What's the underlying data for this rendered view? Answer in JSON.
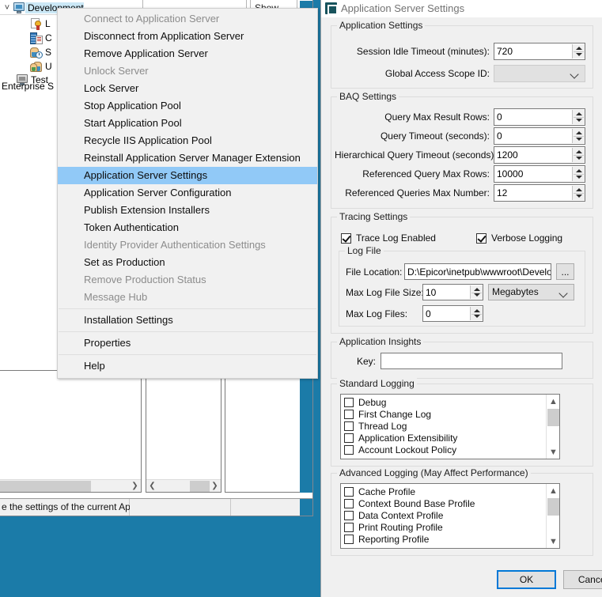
{
  "background_window": {
    "toolbar": {
      "show_label": "Show ..."
    },
    "tree": {
      "root": {
        "label": "Development",
        "icon": "monitor-icon",
        "expanded": true,
        "selected": true
      },
      "children": [
        {
          "label": "L",
          "icon": "certificate-icon"
        },
        {
          "label": "C",
          "icon": "company-icon"
        },
        {
          "label": "S",
          "icon": "sessions-icon"
        },
        {
          "label": "U",
          "icon": "users-icon"
        }
      ],
      "sibling": {
        "label": "Test",
        "icon": "monitor-gray-icon"
      },
      "footer": "Enterprise S"
    },
    "statusbar": {
      "text": "e the settings of the current App"
    }
  },
  "context_menu": {
    "items": [
      {
        "label": "Connect to Application Server",
        "disabled": true,
        "selected": false
      },
      {
        "label": "Disconnect from Application Server",
        "disabled": false,
        "selected": false
      },
      {
        "label": "Remove Application Server",
        "disabled": false,
        "selected": false
      },
      {
        "label": "Unlock Server",
        "disabled": true,
        "selected": false
      },
      {
        "label": "Lock Server",
        "disabled": false,
        "selected": false
      },
      {
        "label": "Stop Application Pool",
        "disabled": false,
        "selected": false
      },
      {
        "label": "Start Application Pool",
        "disabled": false,
        "selected": false
      },
      {
        "label": "Recycle IIS Application Pool",
        "disabled": false,
        "selected": false
      },
      {
        "label": "Reinstall Application Server Manager Extension",
        "disabled": false,
        "selected": false
      },
      {
        "label": "Application Server Settings",
        "disabled": false,
        "selected": true
      },
      {
        "label": "Application Server Configuration",
        "disabled": false,
        "selected": false
      },
      {
        "label": "Publish Extension Installers",
        "disabled": false,
        "selected": false
      },
      {
        "label": "Token Authentication",
        "disabled": false,
        "selected": false
      },
      {
        "label": "Identity Provider Authentication Settings",
        "disabled": true,
        "selected": false
      },
      {
        "label": "Set as Production",
        "disabled": false,
        "selected": false
      },
      {
        "label": "Remove Production Status",
        "disabled": true,
        "selected": false
      },
      {
        "label": "Message Hub",
        "disabled": true,
        "selected": false
      },
      {
        "label": "Installation Settings",
        "disabled": false,
        "selected": false
      },
      {
        "label": "Properties",
        "disabled": false,
        "selected": false
      },
      {
        "label": "Help",
        "disabled": false,
        "selected": false
      }
    ]
  },
  "dialog": {
    "title": "Application Server Settings",
    "application_settings": {
      "caption": "Application Settings",
      "session_idle_timeout_label": "Session Idle Timeout (minutes):",
      "session_idle_timeout_value": "720",
      "global_access_scope_label": "Global Access Scope ID:",
      "global_access_scope_value": ""
    },
    "baq_settings": {
      "caption": "BAQ Settings",
      "fields": [
        {
          "label": "Query Max Result Rows:",
          "value": "0"
        },
        {
          "label": "Query Timeout (seconds):",
          "value": "0"
        },
        {
          "label": "Hierarchical Query Timeout (seconds):",
          "value": "1200"
        },
        {
          "label": "Referenced Query Max Rows:",
          "value": "10000"
        },
        {
          "label": "Referenced Queries Max Number:",
          "value": "12"
        }
      ]
    },
    "tracing_settings": {
      "caption": "Tracing Settings",
      "trace_log_enabled_label": "Trace Log Enabled",
      "trace_log_enabled_checked": true,
      "verbose_logging_label": "Verbose Logging",
      "verbose_logging_checked": true,
      "log_file": {
        "caption": "Log File",
        "file_location_label": "File Location:",
        "file_location_value": "D:\\Epicor\\inetpub\\wwwroot\\Develo",
        "browse_label": "...",
        "max_log_file_size_label": "Max Log File Size:",
        "max_log_file_size_value": "10",
        "size_unit_value": "Megabytes",
        "max_log_files_label": "Max Log Files:",
        "max_log_files_value": "0"
      }
    },
    "application_insights": {
      "caption": "Application Insights",
      "key_label": "Key:",
      "key_value": ""
    },
    "standard_logging": {
      "caption": "Standard Logging",
      "items": [
        {
          "label": "Debug",
          "checked": false
        },
        {
          "label": "First Change Log",
          "checked": false
        },
        {
          "label": "Thread Log",
          "checked": false
        },
        {
          "label": "Application Extensibility",
          "checked": false
        },
        {
          "label": "Account Lockout Policy",
          "checked": false
        }
      ]
    },
    "advanced_logging": {
      "caption": "Advanced Logging (May Affect Performance)",
      "items": [
        {
          "label": "Cache Profile",
          "checked": false
        },
        {
          "label": "Context Bound Base Profile",
          "checked": false
        },
        {
          "label": "Data Context Profile",
          "checked": false
        },
        {
          "label": "Print Routing Profile",
          "checked": false
        },
        {
          "label": "Reporting Profile",
          "checked": false
        }
      ]
    },
    "buttons": {
      "ok": "OK",
      "cancel": "Cancel"
    }
  },
  "colors": {
    "desktop": "#1b7ba8",
    "accent": "#0078d7",
    "menu_selection": "#91c9f7",
    "dialog_bg": "#f0f0f0"
  }
}
